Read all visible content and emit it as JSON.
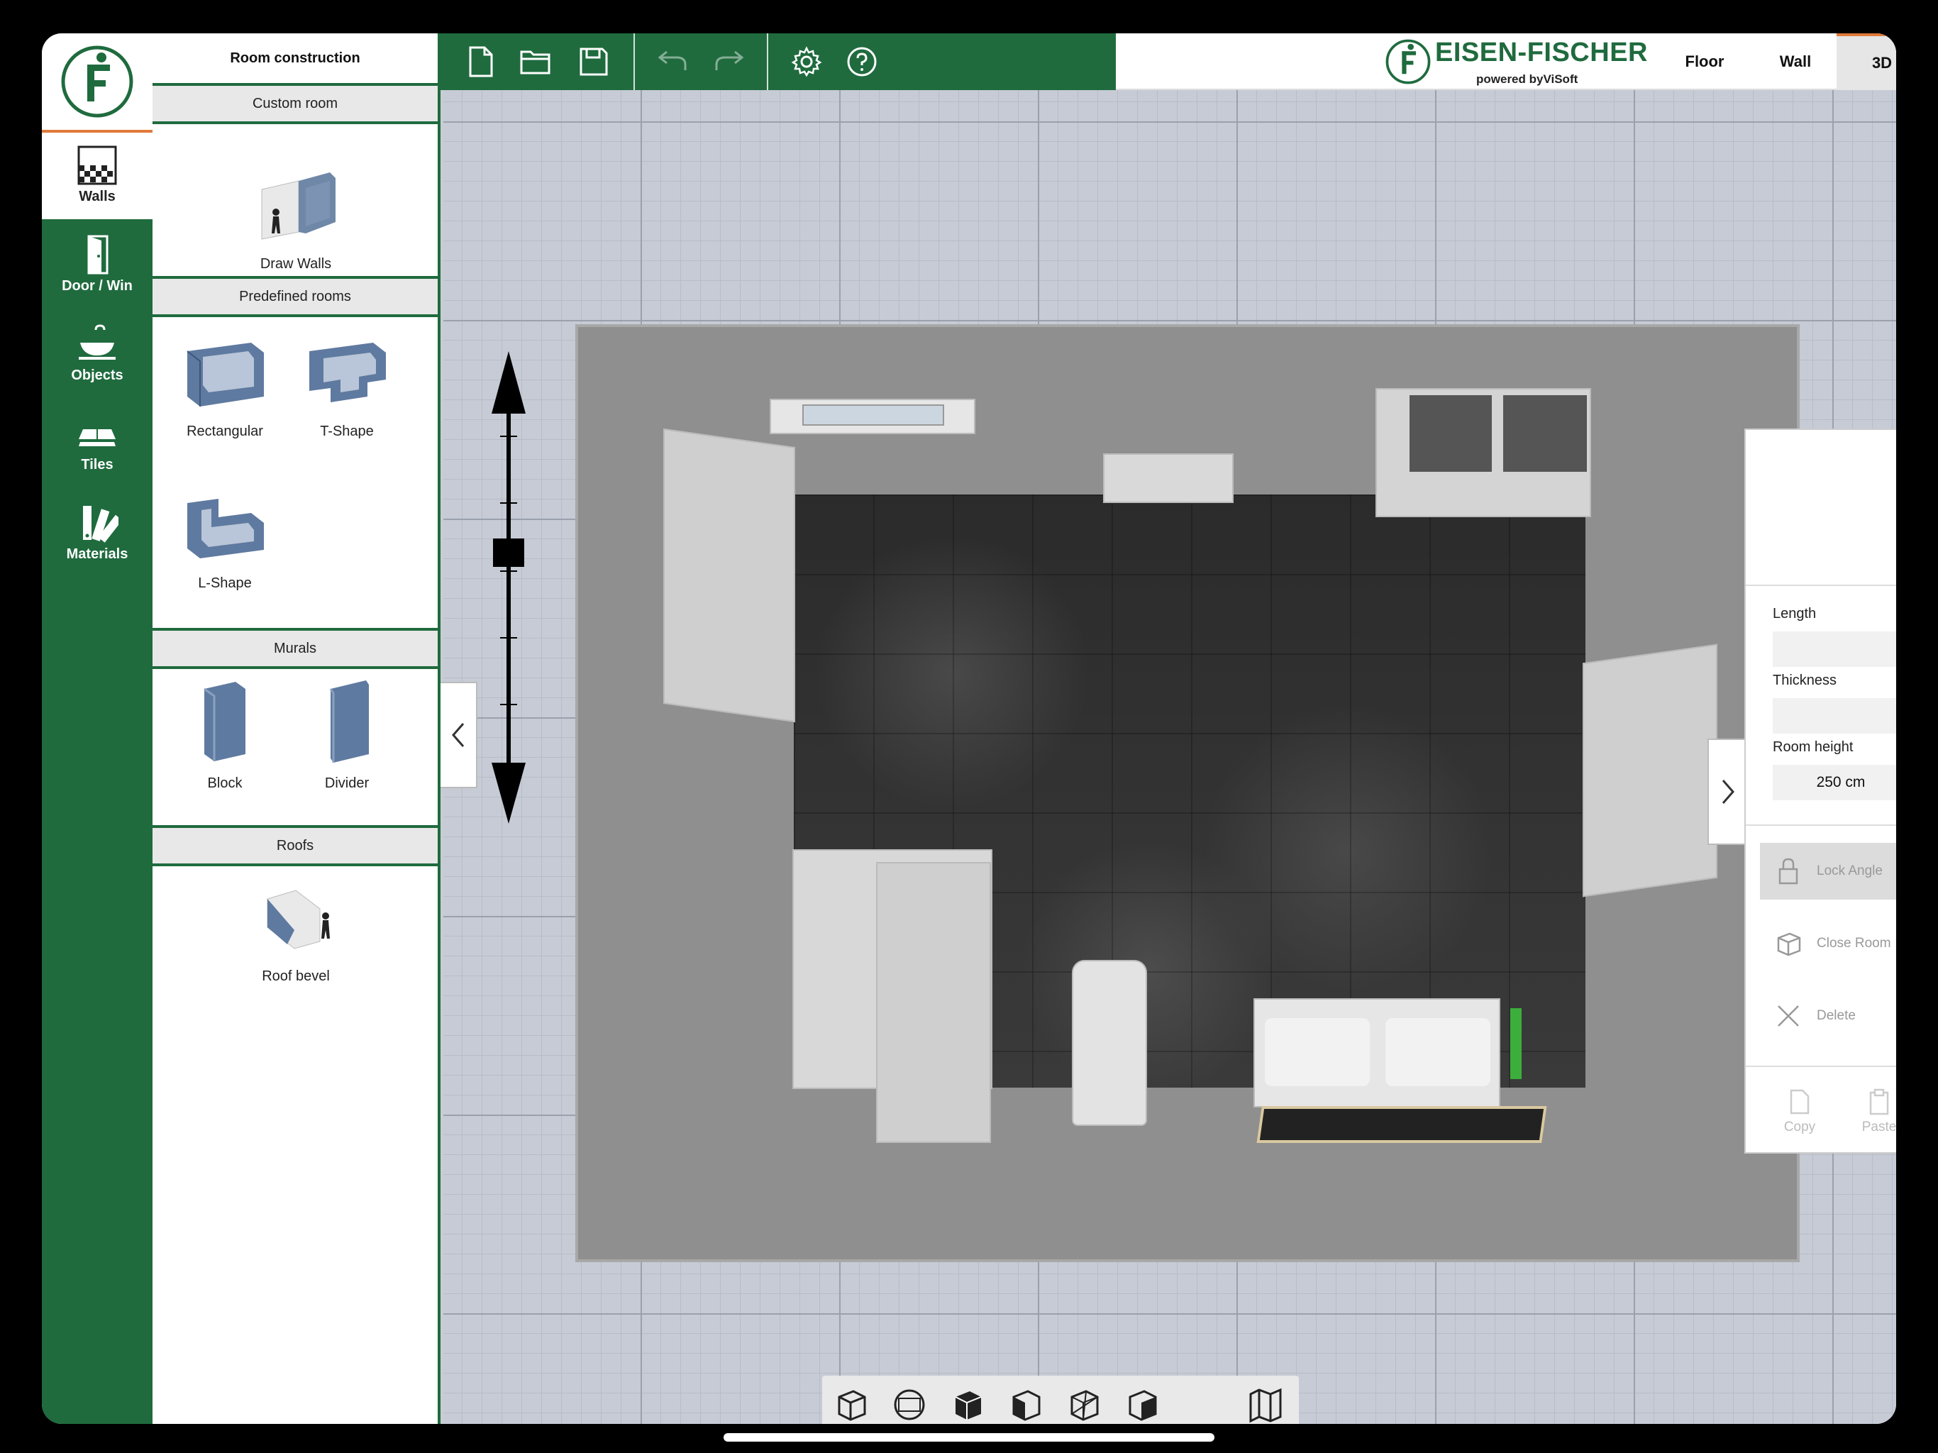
{
  "nav": {
    "items": [
      {
        "label": "Walls",
        "icon": "walls-icon"
      },
      {
        "label": "Door / Win",
        "icon": "door-icon"
      },
      {
        "label": "Objects",
        "icon": "sink-icon"
      },
      {
        "label": "Tiles",
        "icon": "tiles-icon"
      },
      {
        "label": "Materials",
        "icon": "materials-icon"
      }
    ]
  },
  "panel": {
    "title": "Room construction",
    "sections": {
      "custom": {
        "header": "Custom room",
        "items": [
          "Draw Walls"
        ]
      },
      "predefined": {
        "header": "Predefined rooms",
        "items": [
          "Rectangular",
          "T-Shape",
          "L-Shape"
        ]
      },
      "murals": {
        "header": "Murals",
        "items": [
          "Block",
          "Divider"
        ]
      },
      "roofs": {
        "header": "Roofs",
        "items": [
          "Roof bevel"
        ]
      }
    }
  },
  "brand": {
    "name": "EISEN-FISCHER",
    "sub": "powered byViSoft"
  },
  "view_tabs": [
    "Floor",
    "Wall",
    "3D"
  ],
  "active_view": "3D",
  "props": {
    "length_label": "Length",
    "length_value": "",
    "thickness_label": "Thickness",
    "thickness_value": "",
    "room_height_label": "Room height",
    "room_height_value": "250 cm",
    "lock_angle": "Lock Angle",
    "close_room": "Close Room",
    "delete": "Delete",
    "copy": "Copy",
    "paste": "Paste"
  },
  "colors": {
    "brand_green": "#1f6b3e",
    "accent_orange": "#e07a3a"
  }
}
